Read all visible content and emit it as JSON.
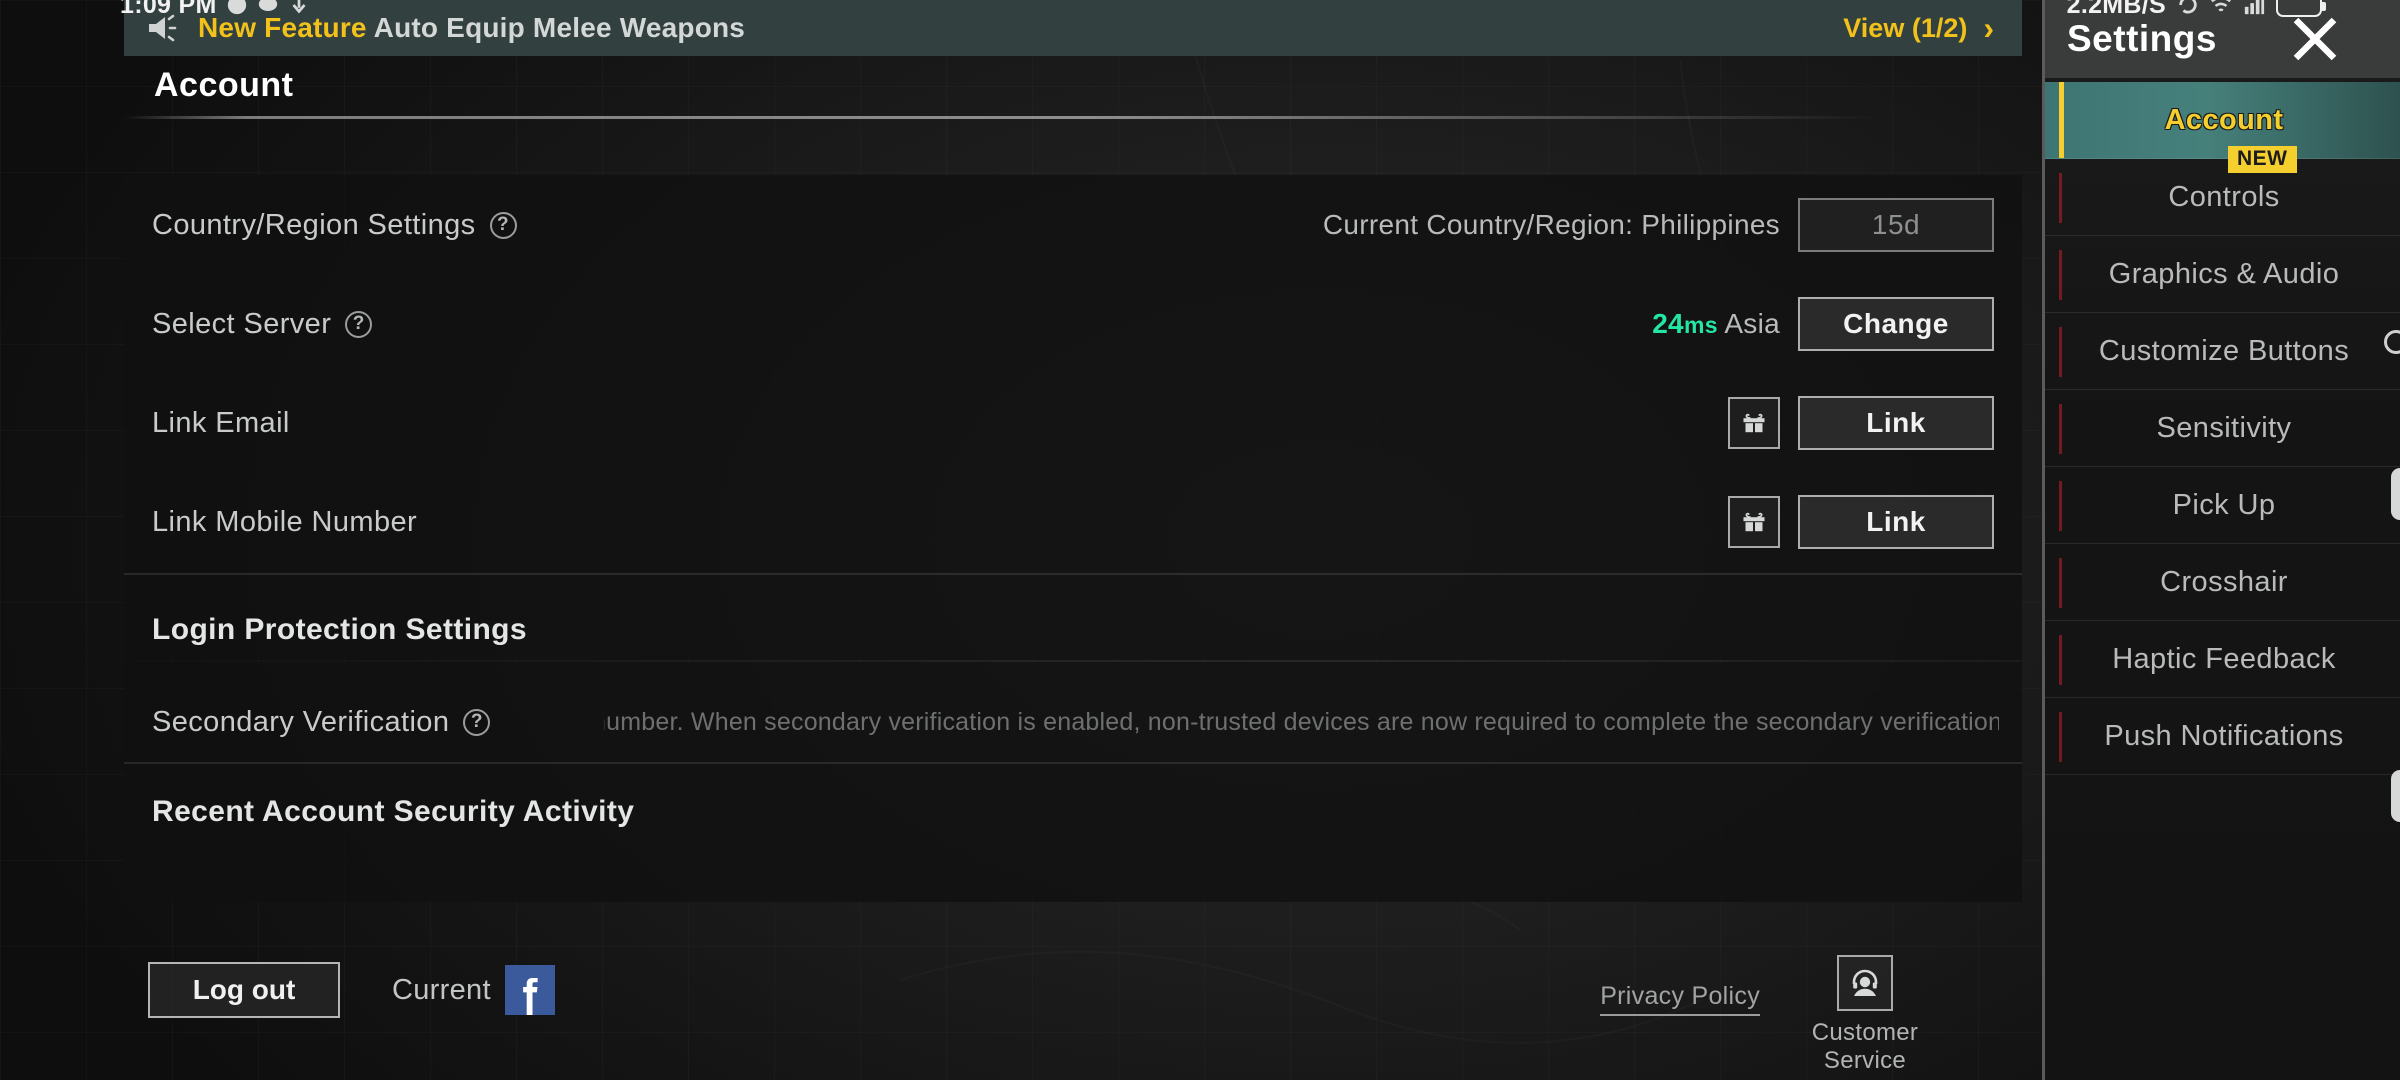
{
  "statusbar": {
    "time": "1:09 PM",
    "data_rate": "2.2MB/S",
    "icons": [
      "message-icon",
      "chat-icon",
      "download-icon",
      "wifi-icon",
      "signal-icon",
      "battery-icon"
    ]
  },
  "banner": {
    "tag": "New Feature",
    "message": "Auto Equip Melee Weapons",
    "view_label": "View (1/2)",
    "chevron": "›",
    "tag_color": "#f2c21b"
  },
  "content": {
    "tab_label": "Account",
    "rows": [
      {
        "label": "Country/Region Settings",
        "help": "?",
        "value": "Current Country/Region: Philippines",
        "button": "15d",
        "button_state": "disabled"
      },
      {
        "label": "Select Server",
        "help": "?",
        "ping": "24",
        "ping_unit": "ms",
        "server": "Asia",
        "button": "Change",
        "ping_color": "#23e6a4"
      },
      {
        "label": "Link Email",
        "gift": "gift-icon",
        "button": "Link"
      },
      {
        "label": "Link Mobile Number",
        "gift": "gift-icon",
        "button": "Link"
      }
    ],
    "login_protection_title": "Login Protection Settings",
    "secondary_verification_label": "Secondary Verification",
    "secondary_verification_help": "?",
    "secondary_verification_marquee": "ɔne number. When secondary verification is enabled, non-trusted devices are now required to complete the secondary verification to enter the ga",
    "recent_activity_title": "Recent Account Security Activity"
  },
  "footer": {
    "logout_label": "Log out",
    "current_label": "Current",
    "current_account_icon": "facebook-icon",
    "facebook_color": "#3b5a9b",
    "privacy_policy": "Privacy Policy",
    "customer_service": "Customer Service"
  },
  "sidebar": {
    "title": "Settings",
    "close_icon": "close-icon",
    "items": [
      {
        "label": "Account",
        "active": true
      },
      {
        "label": "Controls",
        "active": false,
        "badge": "NEW"
      },
      {
        "label": "Graphics & Audio",
        "active": false
      },
      {
        "label": "Customize Buttons",
        "active": false
      },
      {
        "label": "Sensitivity",
        "active": false
      },
      {
        "label": "Pick Up",
        "active": false
      },
      {
        "label": "Crosshair",
        "active": false
      },
      {
        "label": "Haptic Feedback",
        "active": false
      },
      {
        "label": "Push Notifications",
        "active": false
      }
    ],
    "active_color": "#f5cf2e"
  }
}
